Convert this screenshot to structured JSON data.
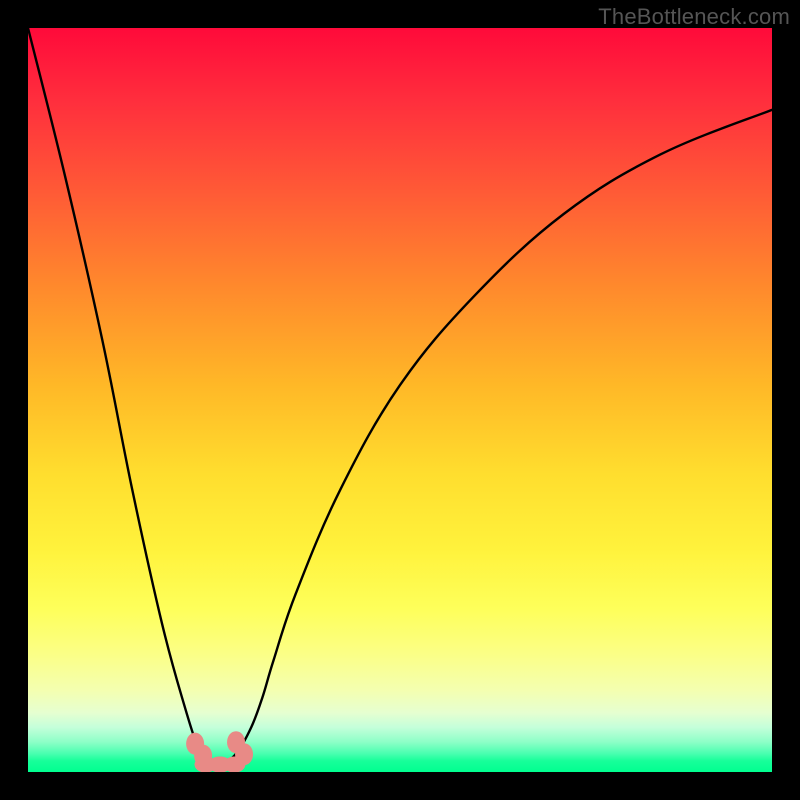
{
  "watermark": "TheBottleneck.com",
  "chart_data": {
    "type": "line",
    "title": "",
    "xlabel": "",
    "ylabel": "",
    "xlim": [
      0,
      100
    ],
    "ylim": [
      0,
      100
    ],
    "grid": false,
    "legend": false,
    "series": [
      {
        "name": "bottleneck-curve",
        "x": [
          0,
          5,
          10,
          14,
          18,
          21,
          23,
          24.5,
          26,
          28,
          30,
          31.5,
          33,
          36,
          42,
          50,
          60,
          72,
          85,
          100
        ],
        "values": [
          100,
          80,
          58,
          38,
          20,
          9,
          3,
          1,
          1,
          2.5,
          6,
          10,
          15,
          24,
          38,
          52,
          64,
          75,
          83,
          89
        ]
      }
    ],
    "markers": [
      {
        "name": "marker-left",
        "x": 23.0,
        "y": 3.0
      },
      {
        "name": "marker-right",
        "x": 28.5,
        "y": 3.2
      },
      {
        "name": "marker-bottom-a",
        "x": 24.8,
        "y": 1.0
      },
      {
        "name": "marker-bottom-b",
        "x": 26.8,
        "y": 1.0
      }
    ],
    "colors": {
      "curve": "#000000",
      "marker": "#e88a86",
      "gradient_top": "#ff0a3a",
      "gradient_mid": "#fff23c",
      "gradient_bottom": "#00ff90"
    }
  }
}
